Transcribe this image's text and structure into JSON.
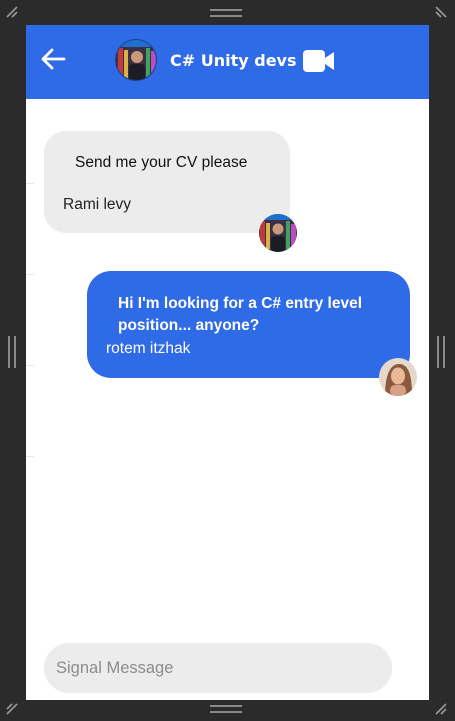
{
  "header": {
    "back_icon": "arrow-left-icon",
    "group_title": "C# Unity devs",
    "video_icon": "video-camera-icon",
    "background_color": "#2f6be6"
  },
  "messages": [
    {
      "direction": "incoming",
      "text": "Send me your CV please",
      "sender": "Rami levy",
      "bubble_color": "#ececec"
    },
    {
      "direction": "outgoing",
      "text": "Hi I'm looking for a C# entry level position... anyone?",
      "sender": "rotem itzhak",
      "bubble_color": "#2f6be6"
    }
  ],
  "composer": {
    "placeholder": "Signal Message",
    "value": ""
  }
}
